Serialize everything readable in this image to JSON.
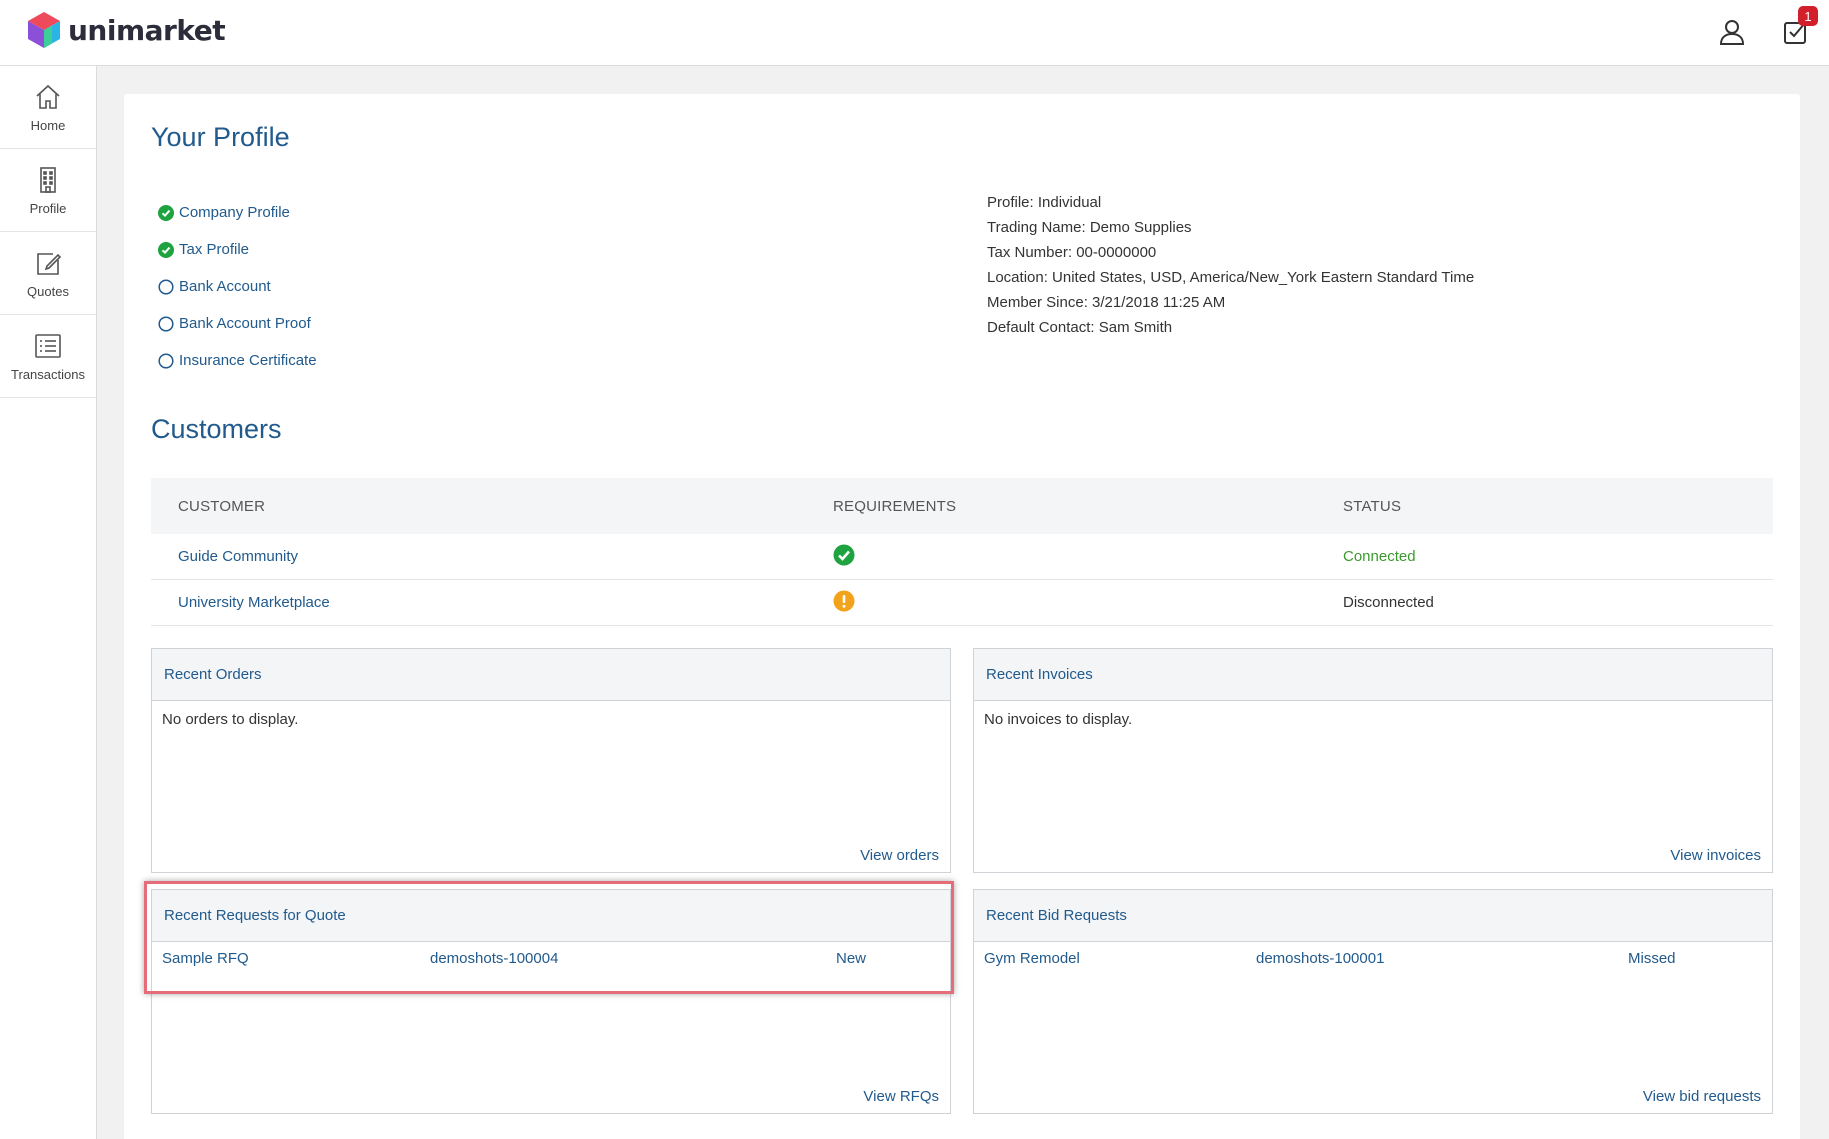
{
  "brand": {
    "name": "unimarket"
  },
  "header": {
    "notification_count": "1"
  },
  "sidebar": {
    "items": [
      {
        "label": "Home",
        "icon": "home-icon"
      },
      {
        "label": "Profile",
        "icon": "building-icon"
      },
      {
        "label": "Quotes",
        "icon": "edit-icon"
      },
      {
        "label": "Transactions",
        "icon": "list-icon"
      }
    ]
  },
  "profile": {
    "title": "Your Profile",
    "checklist": [
      {
        "label": "Company Profile",
        "done": true
      },
      {
        "label": "Tax Profile",
        "done": true
      },
      {
        "label": "Bank Account",
        "done": false
      },
      {
        "label": "Bank Account Proof",
        "done": false
      },
      {
        "label": "Insurance Certificate",
        "done": false
      }
    ],
    "info": [
      "Profile: Individual",
      "Trading Name: Demo Supplies",
      "Tax Number: 00-0000000",
      "Location: United States, USD, America/New_York Eastern Standard Time",
      "Member Since: 3/21/2018 11:25 AM",
      "Default Contact: Sam Smith"
    ]
  },
  "customers": {
    "title": "Customers",
    "headers": [
      "CUSTOMER",
      "REQUIREMENTS",
      "STATUS"
    ],
    "rows": [
      {
        "name": "Guide Community",
        "requirement": "met",
        "status": "Connected"
      },
      {
        "name": "University Marketplace",
        "requirement": "warning",
        "status": "Disconnected"
      }
    ]
  },
  "panels": {
    "orders": {
      "title": "Recent Orders",
      "empty": "No orders to display.",
      "link": "View orders"
    },
    "invoices": {
      "title": "Recent Invoices",
      "empty": "No invoices to display.",
      "link": "View invoices"
    },
    "rfqs": {
      "title": "Recent Requests for Quote",
      "row": {
        "name": "Sample RFQ",
        "id": "demoshots-100004",
        "status": "New"
      },
      "link": "View RFQs"
    },
    "bids": {
      "title": "Recent Bid Requests",
      "row": {
        "name": "Gym Remodel",
        "id": "demoshots-100001",
        "status": "Missed"
      },
      "link": "View bid requests"
    }
  },
  "colors": {
    "link": "#215a8c",
    "success": "#1fa340",
    "warning": "#f3a21b",
    "highlight": "#e56c79"
  }
}
